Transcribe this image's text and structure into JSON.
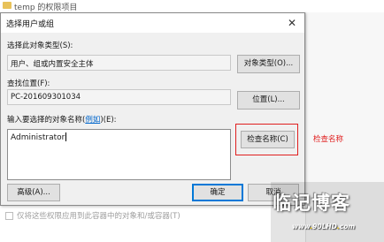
{
  "background_window": {
    "title": "temp 的权限项目",
    "checkbox_label": "仅将这些权限应用到此容器中的对象和/或容器(T)"
  },
  "dialog": {
    "title": "选择用户或组",
    "close_glyph": "✕",
    "object_type_label": "选择此对象类型(S):",
    "object_type_value": "用户、组或内置安全主体",
    "object_type_button": "对象类型(O)...",
    "location_label": "查找位置(F):",
    "location_value": "PC-201609301034",
    "location_button": "位置(L)...",
    "names_label_prefix": "输入要选择的对象名称(",
    "names_label_link": "例如",
    "names_label_suffix": ")(E):",
    "names_value": "Administrator",
    "check_names_button": "检查名称(C)",
    "advanced_button": "高级(A)...",
    "ok_button": "确定",
    "cancel_button": "取消"
  },
  "annotation": {
    "note": "检查名称",
    "color": "#e01f1f"
  },
  "watermark": {
    "brand": "临记博客",
    "url_prefix": "www",
    "url_dot1": ".",
    "url_domain": "90LHD",
    "url_dot2": ".",
    "url_tld": "com"
  }
}
